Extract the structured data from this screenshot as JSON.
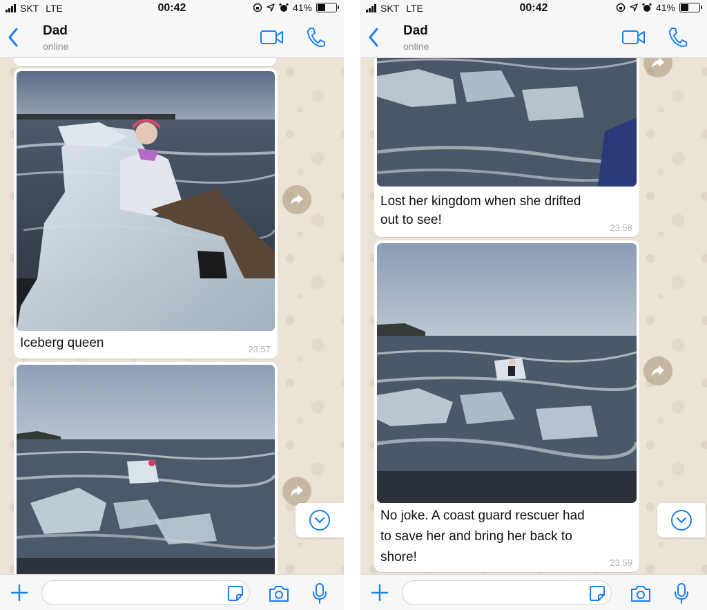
{
  "left": {
    "status": {
      "carrier": "SKT",
      "network": "LTE",
      "time": "00:42",
      "battery": "41%",
      "battery_level": 0.41
    },
    "header": {
      "name": "Dad",
      "status": "online"
    },
    "messages": [
      {
        "caption": "Iceberg queen",
        "time": "23:57"
      }
    ],
    "input": {
      "placeholder": ""
    }
  },
  "right": {
    "status": {
      "carrier": "SKT",
      "network": "LTE",
      "time": "00:42",
      "battery": "41%",
      "battery_level": 0.41
    },
    "header": {
      "name": "Dad",
      "status": "online"
    },
    "messages": [
      {
        "caption_lines": [
          "Lost her kingdom when she drifted",
          "out to see!"
        ],
        "time": "23:58"
      },
      {
        "caption_lines": [
          "No joke. A coast guard rescuer had",
          "to save her and bring her back to",
          "shore!"
        ],
        "time": "23:59"
      }
    ],
    "input": {
      "placeholder": ""
    }
  },
  "colors": {
    "accent": "#1a7ef0",
    "bubble": "#ffffff",
    "chat_bg": "#ebe3d6",
    "timestamp": "#b0b0b0"
  }
}
